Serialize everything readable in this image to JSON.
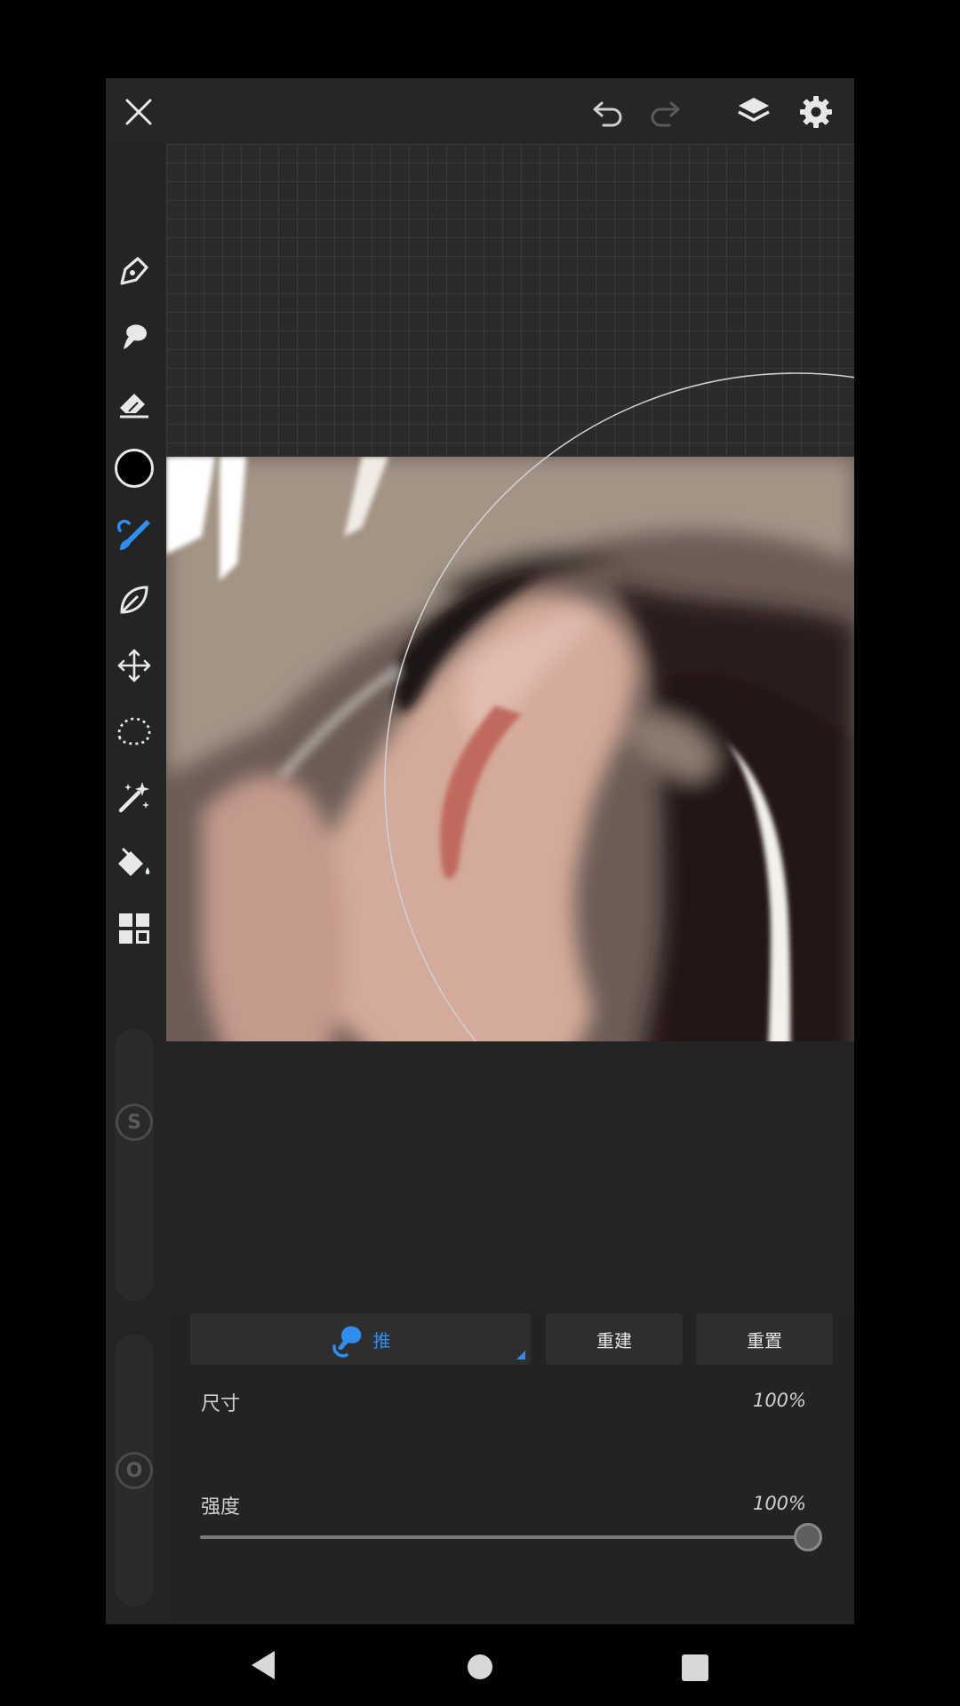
{
  "toolbar": {
    "tools": [
      {
        "name": "pen-tool-icon"
      },
      {
        "name": "smudge-tool-icon"
      },
      {
        "name": "eraser-tool-icon"
      },
      {
        "name": "color-swatch",
        "color": "#000000"
      },
      {
        "name": "liquify-brush-icon",
        "active": true
      },
      {
        "name": "leaf-tool-icon"
      },
      {
        "name": "transform-tool-icon"
      },
      {
        "name": "lasso-selection-icon"
      },
      {
        "name": "magic-wand-icon"
      },
      {
        "name": "fill-bucket-icon"
      },
      {
        "name": "gallery-grid-icon"
      }
    ],
    "size_slider_letter": "S",
    "opacity_slider_letter": "O"
  },
  "topbar": {
    "icons": [
      "close-icon",
      "undo-icon",
      "redo-icon",
      "layers-icon",
      "settings-icon"
    ]
  },
  "panel": {
    "mode_label": "推",
    "rebuild_label": "重建",
    "reset_label": "重置",
    "size": {
      "label": "尺寸",
      "value_text": "100%",
      "value": 1.0
    },
    "strength": {
      "label": "强度",
      "value_text": "100%",
      "value": 1.0
    }
  },
  "colors": {
    "accent": "#2f8ef0",
    "background": "#242424"
  },
  "navbar": {
    "icons": [
      "back-icon",
      "home-icon",
      "recents-icon"
    ]
  }
}
